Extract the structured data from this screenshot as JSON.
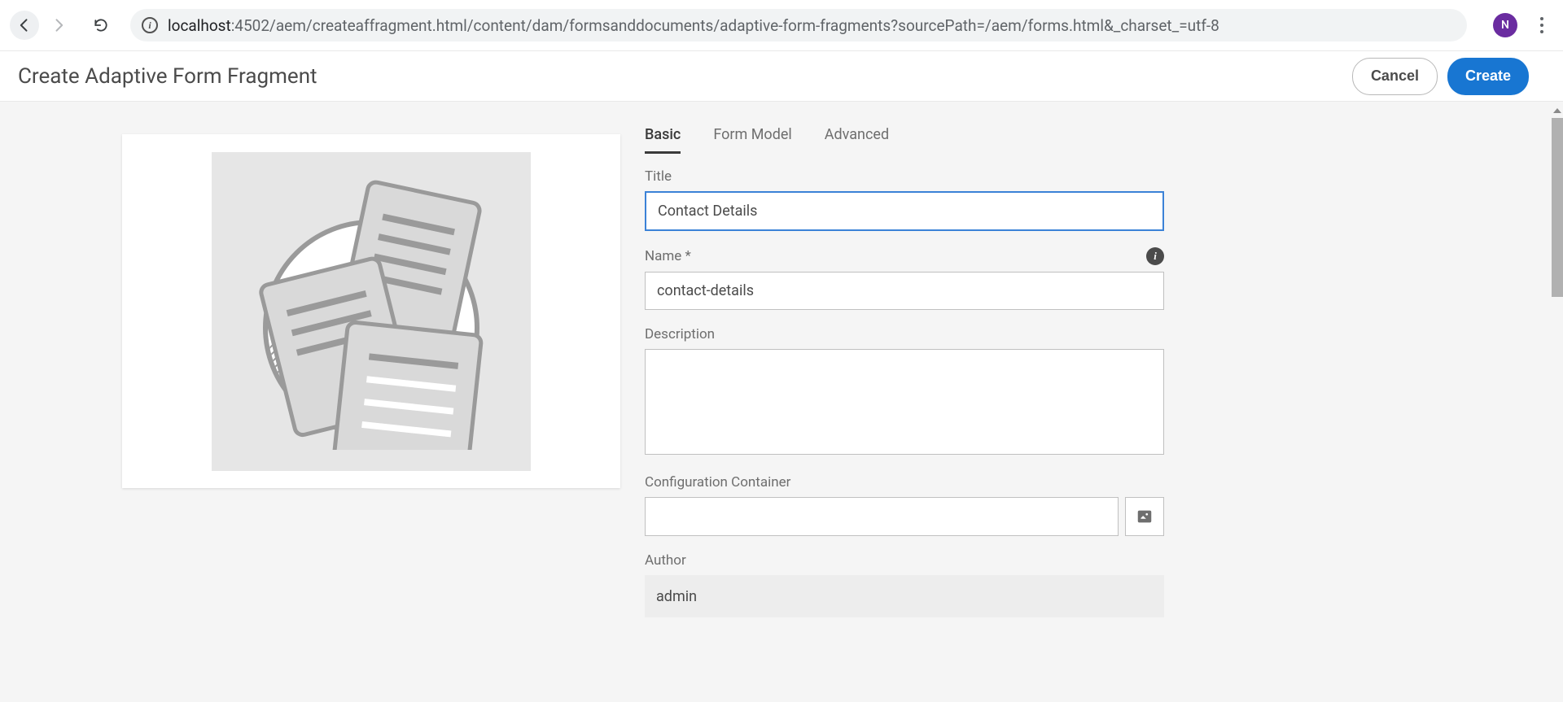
{
  "browser": {
    "url_host": "localhost",
    "url_path": ":4502/aem/createaffragment.html/content/dam/formsanddocuments/adaptive-form-fragments?sourcePath=/aem/forms.html&_charset_=utf-8",
    "avatar_initial": "N"
  },
  "header": {
    "title": "Create Adaptive Form Fragment",
    "cancel_label": "Cancel",
    "create_label": "Create"
  },
  "tabs": [
    {
      "label": "Basic",
      "active": true
    },
    {
      "label": "Form Model",
      "active": false
    },
    {
      "label": "Advanced",
      "active": false
    }
  ],
  "form": {
    "title_label": "Title",
    "title_value": "Contact Details",
    "name_label": "Name *",
    "name_value": "contact-details",
    "description_label": "Description",
    "description_value": "",
    "config_container_label": "Configuration Container",
    "config_container_value": "",
    "author_label": "Author",
    "author_value": "admin"
  }
}
